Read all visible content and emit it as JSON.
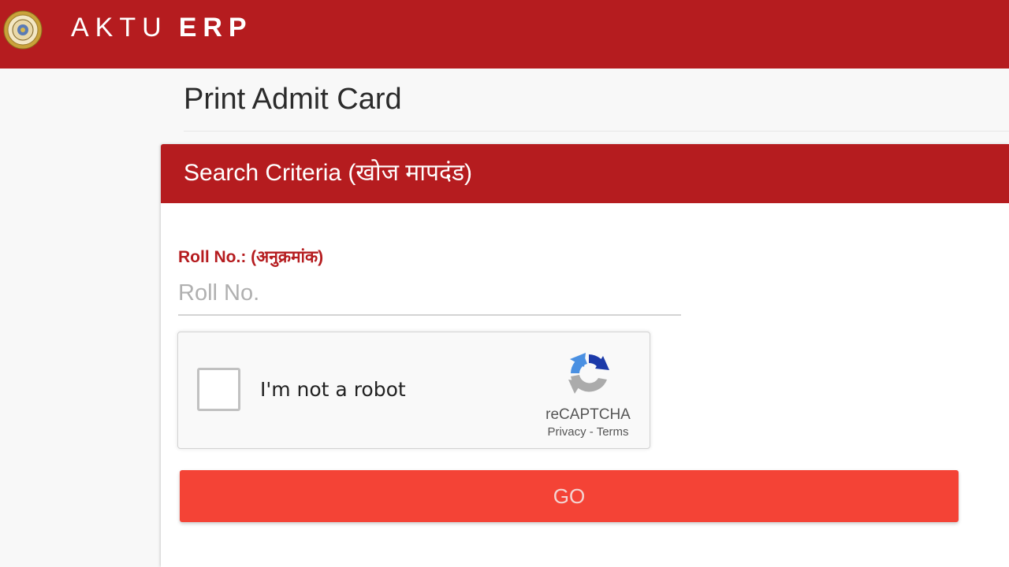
{
  "header": {
    "brand_light": "AKTU",
    "brand_bold": "ERP",
    "logo": "university-seal-icon"
  },
  "page": {
    "title": "Print Admit Card"
  },
  "search_panel": {
    "header": "Search Criteria (खोज मापदंड)",
    "roll_label": "Roll No.: (अनुक्रमांक)",
    "roll_value": "",
    "roll_placeholder": "Roll No.",
    "go_label": "GO"
  },
  "recaptcha": {
    "label": "I'm not a robot",
    "brand": "reCAPTCHA",
    "privacy": "Privacy",
    "separator": "-",
    "terms": "Terms",
    "checked": false,
    "icon": "recaptcha-logo-icon"
  },
  "colors": {
    "brand_red": "#b51c1f",
    "button_red": "#f44336",
    "page_bg": "#f8f8f8"
  }
}
